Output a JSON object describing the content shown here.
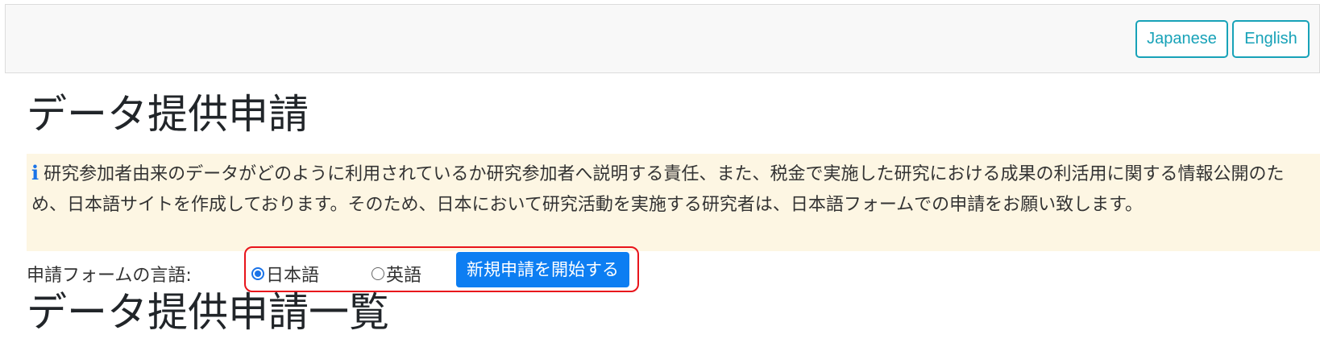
{
  "header": {
    "lang_japanese": "Japanese",
    "lang_english": "English"
  },
  "main": {
    "page_title": "データ提供申請",
    "notice": {
      "icon": "info-icon",
      "text": "研究参加者由来のデータがどのように利用されているか研究参加者へ説明する責任、また、税金で実施した研究における成果の利活用に関する情報公開のため、日本語サイトを作成しております。そのため、日本において研究活動を実施する研究者は、日本語フォームでの申請をお願い致します。"
    },
    "form_language": {
      "label": "申請フォームの言語:",
      "options": [
        {
          "label": "日本語",
          "checked": true
        },
        {
          "label": "英語",
          "checked": false
        }
      ],
      "start_button": "新規申請を開始する"
    },
    "list_title": "データ提供申請一覧"
  },
  "colors": {
    "accent": "#17a2b8",
    "primary_button": "#0d7ef2",
    "notice_bg": "#fdf6e3",
    "highlight_border": "#e8141b"
  }
}
